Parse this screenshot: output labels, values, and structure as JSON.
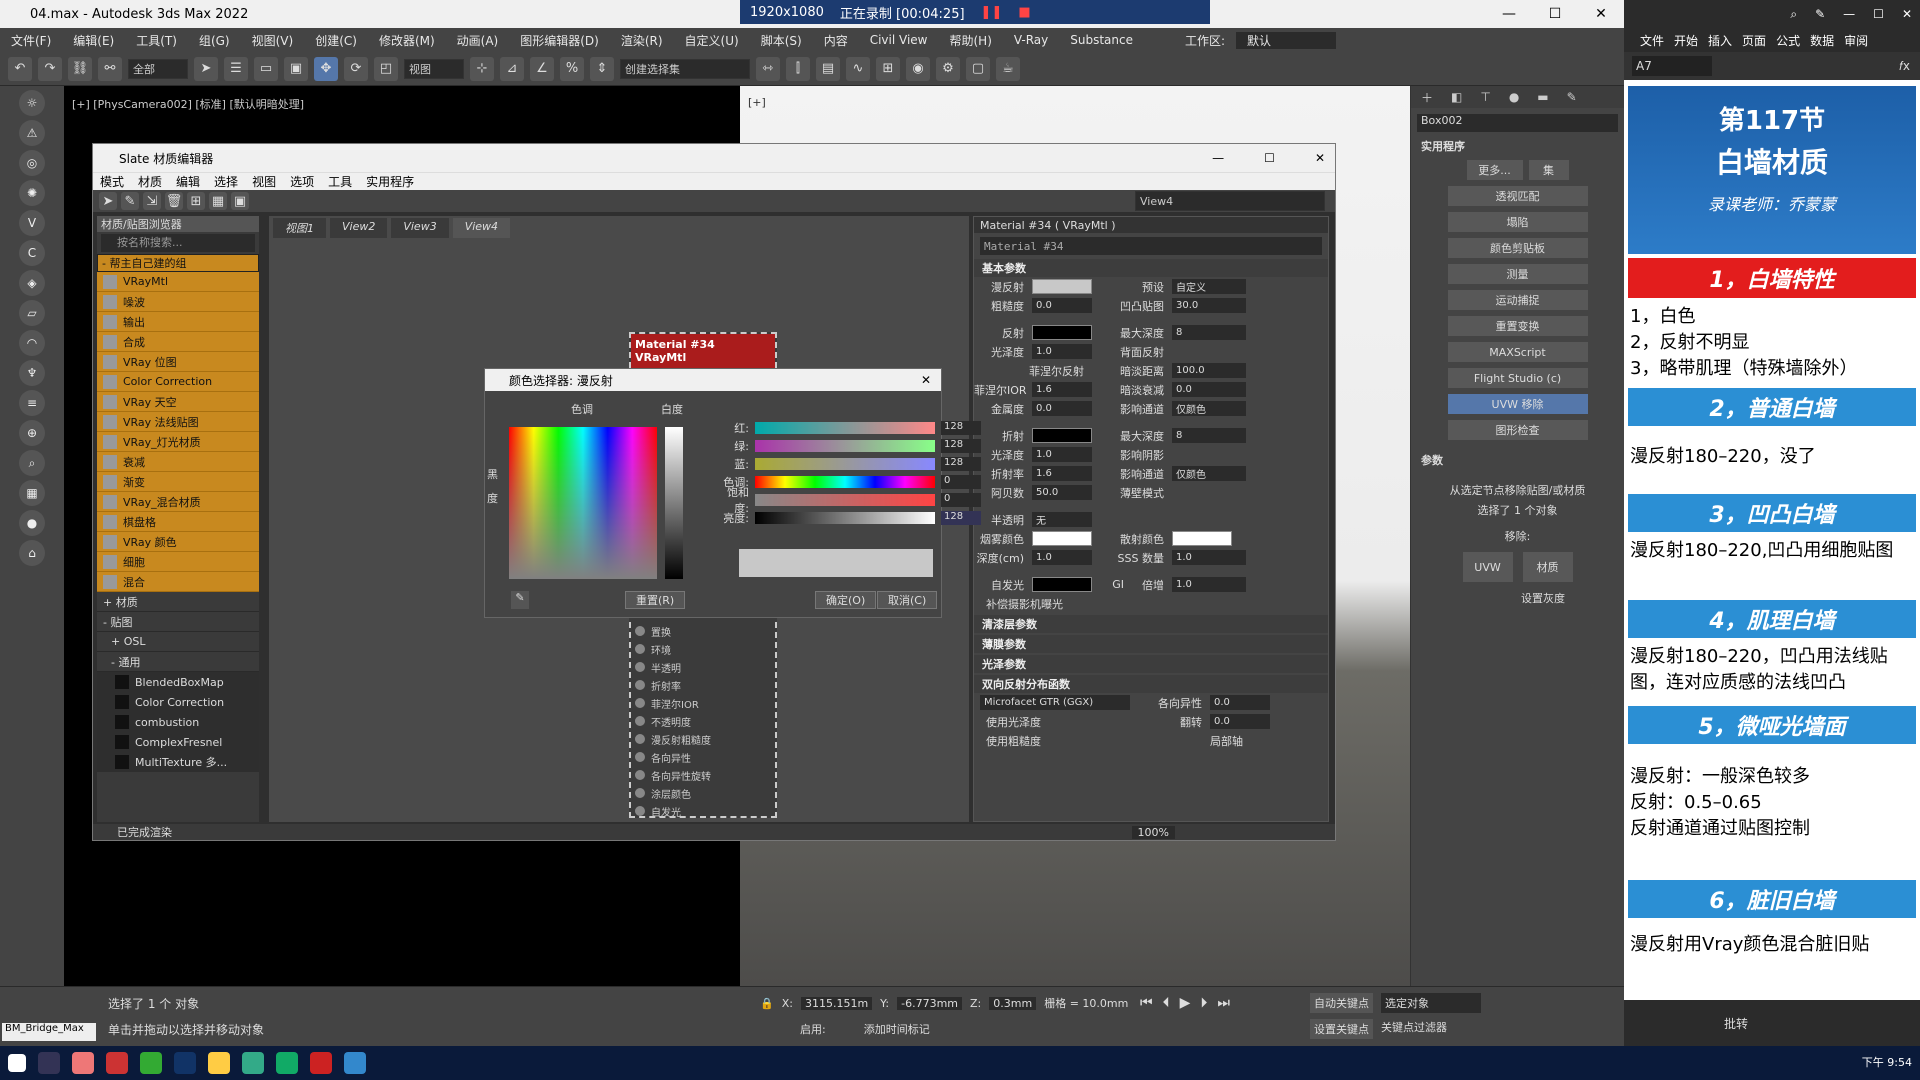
{
  "app": {
    "title": "04.max - Autodesk 3ds Max 2022",
    "recording": {
      "resolution": "1920x1080",
      "status": "正在录制 [00:04:25]"
    }
  },
  "menu": [
    "文件(F)",
    "编辑(E)",
    "工具(T)",
    "组(G)",
    "视图(V)",
    "创建(C)",
    "修改器(M)",
    "动画(A)",
    "图形编辑器(D)",
    "渲染(R)",
    "自定义(U)",
    "脚本(S)",
    "内容",
    "Civil View",
    "帮助(H)",
    "V-Ray",
    "Substance"
  ],
  "workspace": {
    "label": "工作区:",
    "value": "默认"
  },
  "toolbar": {
    "filter": "全部",
    "view": "视图",
    "selection_set": "创建选择集"
  },
  "viewport1": {
    "label": "[+] [PhysCamera002] [标准] [默认明暗处理]"
  },
  "viewport2": {
    "label": "[+]"
  },
  "slate": {
    "title": "Slate 材质编辑器",
    "menu": [
      "模式",
      "材质",
      "编辑",
      "选择",
      "视图",
      "选项",
      "工具",
      "实用程序"
    ],
    "view_dropdown": "View4",
    "browser_title": "材质/贴图浏览器",
    "search_placeholder": "按名称搜索...",
    "group_title": "- 帮主自己建的组",
    "materials": [
      "VRayMtl",
      "噪波",
      "输出",
      "合成",
      "VRay 位图",
      "Color Correction",
      "VRay 天空",
      "VRay 法线贴图",
      "VRay_灯光材质",
      "衰减",
      "渐变",
      "VRay_混合材质",
      "棋盘格",
      "VRay 颜色",
      "细胞",
      "混合"
    ],
    "section_materials": "+ 材质",
    "section_maps": "- 贴图",
    "section_osl": "+ OSL",
    "section_general": "- 通用",
    "maps": [
      "BlendedBoxMap",
      "Color Correction",
      "combustion",
      "ComplexFresnel",
      "MultiTexture 多..."
    ],
    "view_tabs": [
      "视图1",
      "View2",
      "View3",
      "View4"
    ],
    "status": "已完成渲染",
    "zoom": "100%"
  },
  "node": {
    "title": "Material #34",
    "subtitle": "VRayMtl",
    "slots": [
      "置换",
      "环境",
      "半透明",
      "折射率",
      "菲涅尔IOR",
      "不透明度",
      "漫反射粗糙度",
      "各向异性",
      "各向异性旋转",
      "涂层颜色",
      "自发光"
    ]
  },
  "props": {
    "header": "Material #34 ( VRayMtl )",
    "name": "Material #34",
    "basic": "基本参数",
    "diffuse_label": "漫反射",
    "roughness": {
      "label": "粗糙度",
      "value": "0.0"
    },
    "preset": {
      "label": "预设",
      "value": "自定义"
    },
    "bump": {
      "label": "凹凸贴图",
      "value": "30.0"
    },
    "reflect_label": "反射",
    "max_depth": {
      "label": "最大深度",
      "value": "8"
    },
    "gloss": {
      "label": "光泽度",
      "value": "1.0"
    },
    "backside": "背面反射",
    "fresnel": "菲涅尔反射",
    "dim_dist": {
      "label": "暗淡距离",
      "value": "100.0"
    },
    "fresnel_ior": {
      "label": "菲涅尔IOR",
      "value": "1.6"
    },
    "dim_falloff": {
      "label": "暗淡衰减",
      "value": "0.0"
    },
    "metal": {
      "label": "金属度",
      "value": "0.0"
    },
    "affect_ch": {
      "label": "影响通道",
      "value": "仅颜色"
    },
    "refract_label": "折射",
    "r_max_depth": {
      "label": "最大深度",
      "value": "8"
    },
    "r_gloss": {
      "label": "光泽度",
      "value": "1.0"
    },
    "affect_shadow": "影响阴影",
    "ior": {
      "label": "折射率",
      "value": "1.6"
    },
    "r_affect_ch": {
      "label": "影响通道",
      "value": "仅颜色"
    },
    "abbe": {
      "label": "阿贝数",
      "value": "50.0"
    },
    "thin": "薄壁模式",
    "translucency": {
      "label": "半透明",
      "value": "无"
    },
    "fog_color": "烟雾颜色",
    "scatter_color": "散射颜色",
    "depth": {
      "label": "深度(cm)",
      "value": "1.0"
    },
    "sss": {
      "label": "SSS 数量",
      "value": "1.0"
    },
    "self_illum": "自发光",
    "gi": "GI",
    "multiplier": {
      "label": "倍增",
      "value": "1.0"
    },
    "comp_camera": "补偿摄影机曝光",
    "rollouts": [
      "清漆层参数",
      "薄膜参数",
      "光泽参数",
      "双向反射分布函数"
    ],
    "brdf": {
      "type": "Microfacet GTR (GGX)",
      "aniso_label": "各向异性",
      "aniso": "0.0",
      "use_gloss": "使用光泽度",
      "rot_label": "翻转",
      "rot": "0.0",
      "use_rough": "使用粗糙度",
      "local_axis": "局部轴"
    }
  },
  "colorpicker": {
    "title": "颜色选择器: 漫反射",
    "hue_label": "色调",
    "white_label": "白度",
    "black_label": "黑度",
    "rows": [
      {
        "label": "红:",
        "value": "128"
      },
      {
        "label": "绿:",
        "value": "128"
      },
      {
        "label": "蓝:",
        "value": "128"
      },
      {
        "label": "色调:",
        "value": "0"
      },
      {
        "label": "饱和度:",
        "value": "0"
      },
      {
        "label": "亮度:",
        "value": "128"
      }
    ],
    "reset": "重置(R)",
    "ok": "确定(O)",
    "cancel": "取消(C)"
  },
  "cmdpanel": {
    "object": "Box002",
    "utilities": "实用程序",
    "more": "更多...",
    "sets": "集",
    "buttons": [
      "透视匹配",
      "塌陷",
      "颜色剪贴板",
      "测量",
      "运动捕捉",
      "重置变换",
      "MAXScript",
      "Flight Studio (c)",
      "UVW 移除",
      "图形检查"
    ],
    "params": "参数",
    "desc": "从选定节点移除贴图/或材质",
    "selected": "选择了 1 个对象",
    "remove": "移除:",
    "uvw": "UVW",
    "material": "材质",
    "set_gray": "设置灰度"
  },
  "status": {
    "selected": "选择了 1 个 对象",
    "hint": "单击并拖动以选择并移动对象",
    "x": "3115.151m",
    "y": "-6.773mm",
    "z": "0.3mm",
    "grid": "栅格 = 10.0mm",
    "auto_key": "自动关键点",
    "set_key": "设置关键点",
    "sel_obj": "选定对象",
    "key_filter": "关键点过滤器",
    "enabled": "启用:",
    "add_time_tag": "添加时间标记",
    "script_box": "BM_Bridge_Max"
  },
  "excel": {
    "tabs": [
      "文件",
      "开始",
      "插入",
      "页面",
      "公式",
      "数据",
      "审阅"
    ],
    "cell_ref": "A7",
    "banner_line1": "第117节",
    "banner_line2": "白墙材质",
    "banner_line3": "录课老师：乔蒙蒙",
    "section1": "1，白墙特性",
    "s1_items": [
      "1，白色",
      "2，反射不明显",
      "3，略带肌理（特殊墙除外）"
    ],
    "section2": "2，普通白墙",
    "s2_text": "漫反射180–220，没了",
    "section3": "3，凹凸白墙",
    "s3_text": "漫反射180–220,凹凸用细胞贴图",
    "section4": "4，肌理白墙",
    "s4_text": "漫反射180–220，凹凸用法线贴图，连对应质感的法线凹凸",
    "section5": "5，微哑光墙面",
    "s5_text": [
      "漫反射：一般深色较多",
      "反射：0.5–0.65",
      "反射通道通过贴图控制"
    ],
    "section6": "6，脏旧白墙",
    "s6_text": "漫反射用Vray颜色混合脏旧贴",
    "bottom": "批转"
  },
  "clock": "下午 9:54"
}
